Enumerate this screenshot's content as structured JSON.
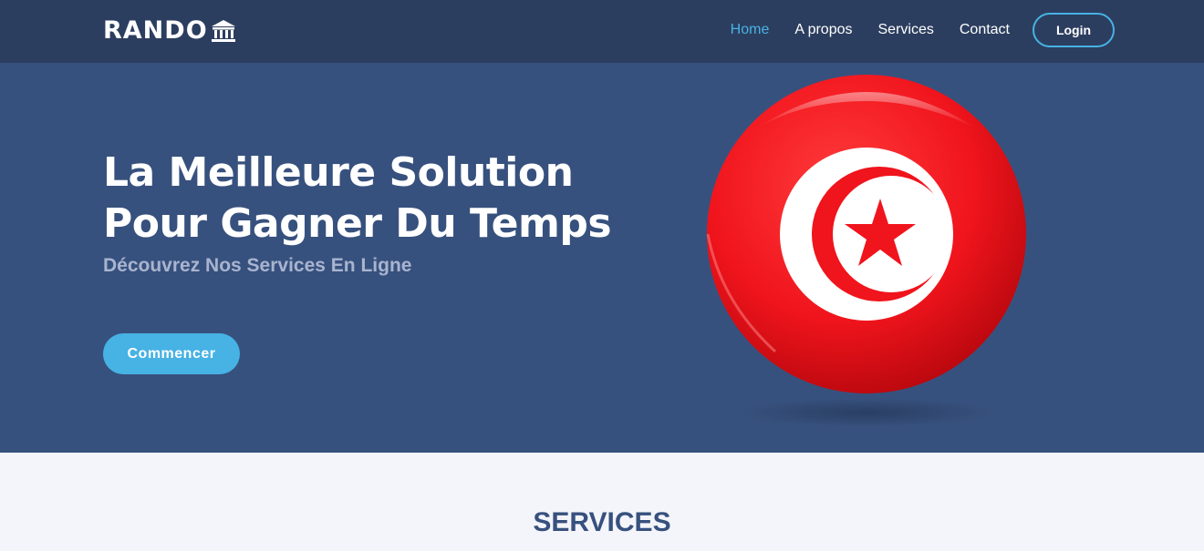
{
  "brand": {
    "name": "RANDO",
    "icon": "bank-icon"
  },
  "nav": {
    "items": [
      {
        "label": "Home",
        "active": true
      },
      {
        "label": "A propos",
        "active": false
      },
      {
        "label": "Services",
        "active": false
      },
      {
        "label": "Contact",
        "active": false
      }
    ],
    "login_label": "Login"
  },
  "hero": {
    "title_line1": "La Meilleure Solution",
    "title_line2": "Pour Gagner Du Temps",
    "subtitle": "Découvrez Nos Services En Ligne",
    "cta_label": "Commencer",
    "image_icon": "tunisia-flag-ball-icon"
  },
  "services": {
    "title": "SERVICES"
  },
  "colors": {
    "navbar_bg": "#2c3e5f",
    "hero_bg": "#37517e",
    "accent": "#47b2e4",
    "page_bg": "#f4f5fa",
    "flag_red": "#e70013"
  }
}
